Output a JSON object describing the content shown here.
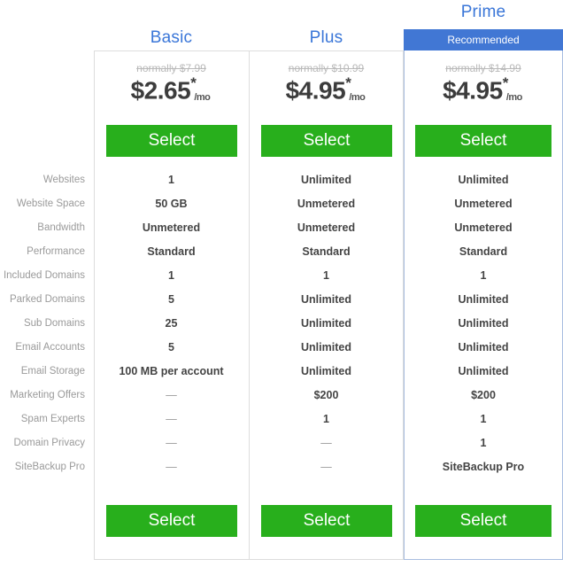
{
  "plans": [
    {
      "name": "Basic",
      "recommended": false,
      "badge_label": "",
      "normally": "normally $7.99",
      "price": "$2.65",
      "star": "*",
      "per": "/mo",
      "select_label_top": "Select",
      "select_label_bottom": "Select"
    },
    {
      "name": "Plus",
      "recommended": false,
      "badge_label": "",
      "normally": "normally $10.99",
      "price": "$4.95",
      "star": "*",
      "per": "/mo",
      "select_label_top": "Select",
      "select_label_bottom": "Select"
    },
    {
      "name": "Prime",
      "recommended": true,
      "badge_label": "Recommended",
      "normally": "normally $14.99",
      "price": "$4.95",
      "star": "*",
      "per": "/mo",
      "select_label_top": "Select",
      "select_label_bottom": "Select"
    }
  ],
  "features": [
    {
      "label": "Websites",
      "values": [
        "1",
        "Unlimited",
        "Unlimited"
      ]
    },
    {
      "label": "Website Space",
      "values": [
        "50 GB",
        "Unmetered",
        "Unmetered"
      ]
    },
    {
      "label": "Bandwidth",
      "values": [
        "Unmetered",
        "Unmetered",
        "Unmetered"
      ]
    },
    {
      "label": "Performance",
      "values": [
        "Standard",
        "Standard",
        "Standard"
      ]
    },
    {
      "label": "Included Domains",
      "values": [
        "1",
        "1",
        "1"
      ]
    },
    {
      "label": "Parked Domains",
      "values": [
        "5",
        "Unlimited",
        "Unlimited"
      ]
    },
    {
      "label": "Sub Domains",
      "values": [
        "25",
        "Unlimited",
        "Unlimited"
      ]
    },
    {
      "label": "Email Accounts",
      "values": [
        "5",
        "Unlimited",
        "Unlimited"
      ]
    },
    {
      "label": "Email Storage",
      "values": [
        "100 MB per account",
        "Unlimited",
        "Unlimited"
      ]
    },
    {
      "label": "Marketing Offers",
      "values": [
        "—",
        "$200",
        "$200"
      ]
    },
    {
      "label": "Spam Experts",
      "values": [
        "—",
        "1",
        "1"
      ]
    },
    {
      "label": "Domain Privacy",
      "values": [
        "—",
        "—",
        "1"
      ]
    },
    {
      "label": "SiteBackup Pro",
      "values": [
        "—",
        "—",
        "SiteBackup Pro"
      ]
    }
  ],
  "colors": {
    "accent_blue": "#4177d4",
    "title_blue": "#3a76d8",
    "button_green": "#28af1c",
    "label_gray": "#9a9a9a",
    "value_gray": "#444444",
    "strike_gray": "#b9b9b9",
    "card_border": "#dddddd",
    "prime_border": "#a8bde0"
  }
}
